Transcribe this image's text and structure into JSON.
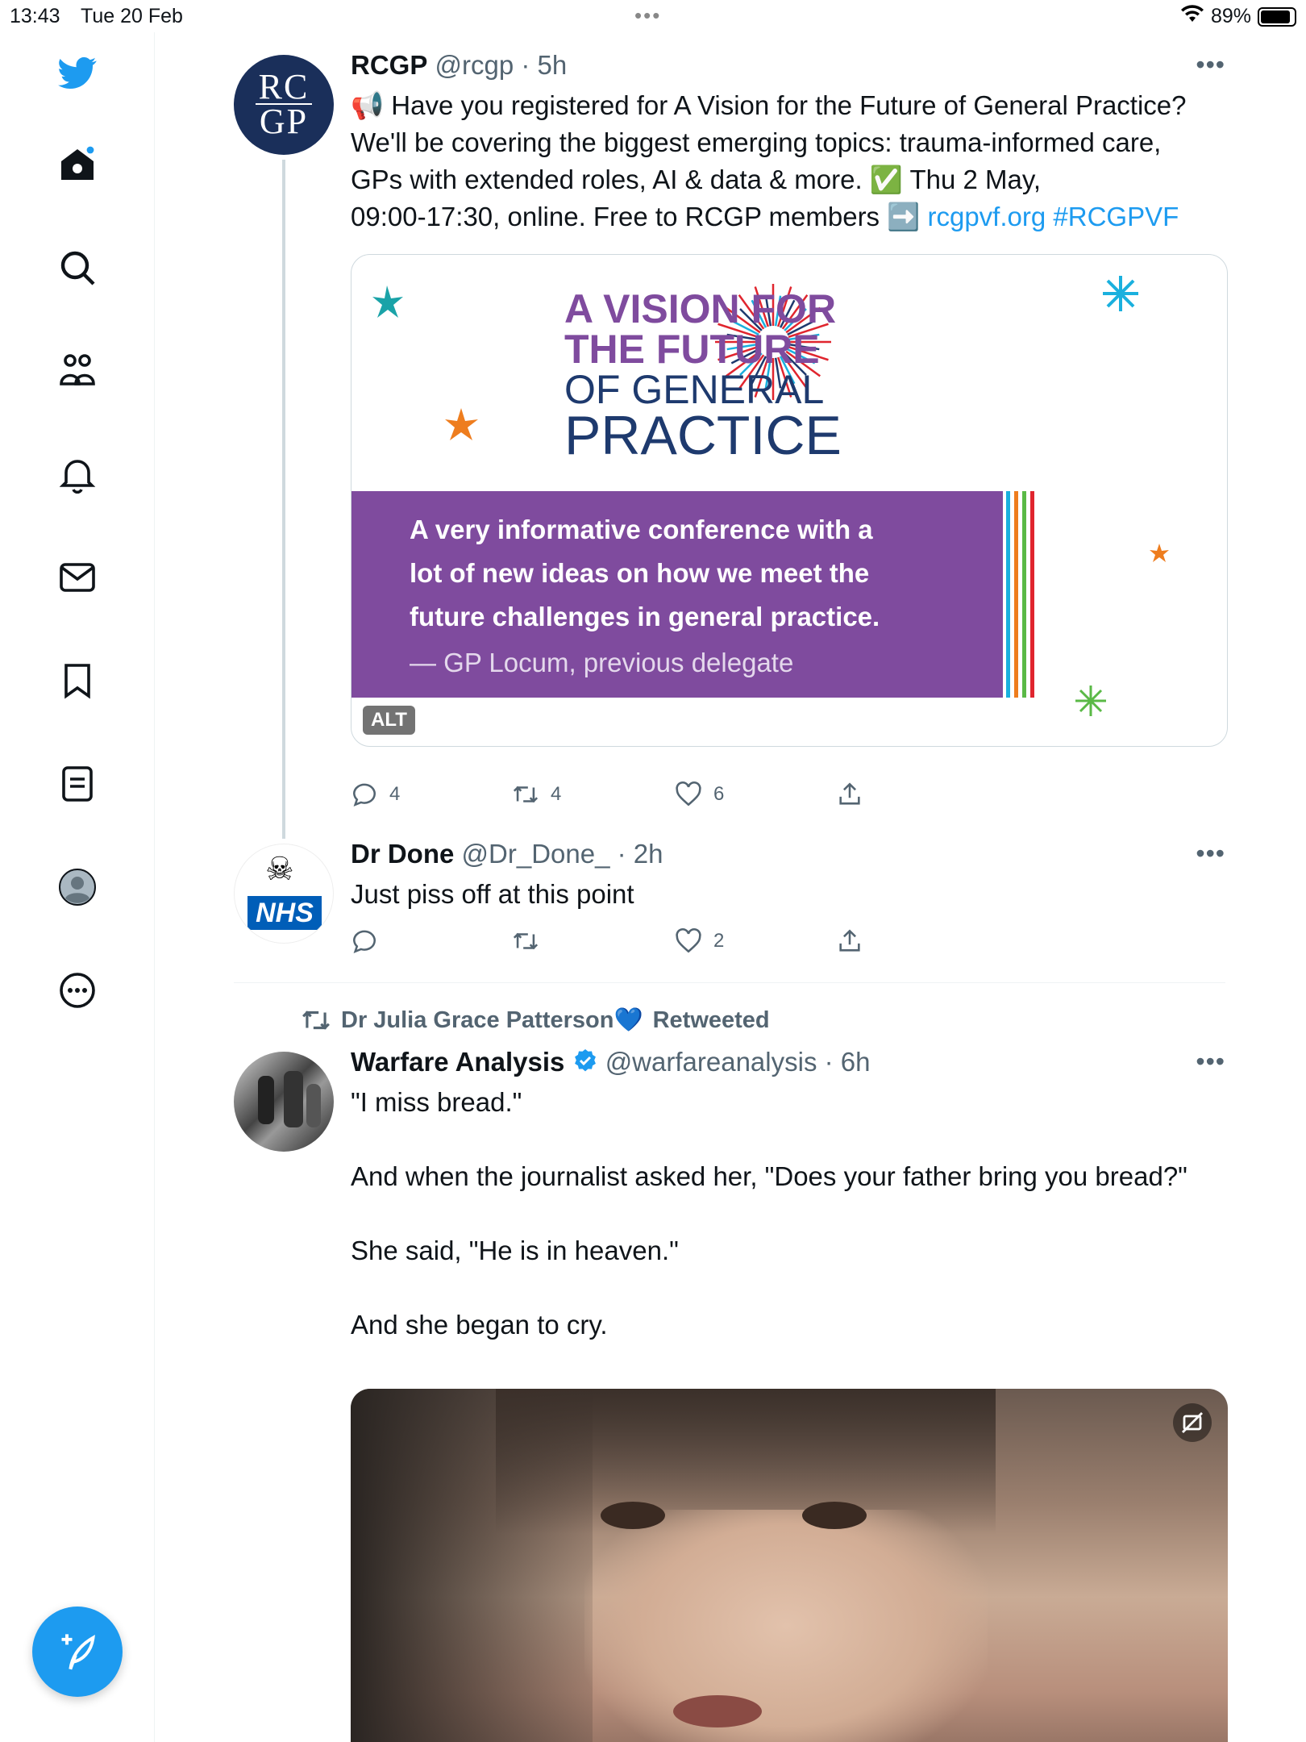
{
  "status_bar": {
    "time": "13:43",
    "date": "Tue 20 Feb",
    "battery": "89%",
    "battery_level": 0.89
  },
  "sidebar": {
    "items": [
      "twitter-logo",
      "home",
      "search",
      "communities",
      "notifications",
      "messages",
      "bookmarks",
      "lists",
      "profile",
      "more"
    ]
  },
  "tweets": [
    {
      "name": "RCGP",
      "handle": "@rcgp",
      "time": "· 5h",
      "avatar_text_top": "RC",
      "avatar_text_bottom": "GP",
      "text_line1": "📢 Have you registered for A Vision for the Future of General Practice?",
      "text_line2": "We'll be covering the biggest emerging topics: trauma-informed care,",
      "text_line3": "GPs with extended roles, AI & data & more. ✅ Thu 2 May,",
      "text_line4_plain": "09:00-17:30, online. Free to RCGP members ➡️ ",
      "text_link": "rcgpvf.org",
      "text_hashtag": "#RCGPVF",
      "card": {
        "title_line1": "A VISION FOR",
        "title_line2": "THE FUTURE",
        "title_line3": "OF GENERAL",
        "title_line4": "PRACTICE",
        "quote_line1": "A very informative conference with a",
        "quote_line2": "lot of new ideas on how we meet the",
        "quote_line3": "future challenges in general practice.",
        "attribution": "— GP Locum, previous delegate",
        "alt": "ALT"
      },
      "replies": "4",
      "retweets": "4",
      "likes": "6"
    },
    {
      "name": "Dr Done",
      "handle": "@Dr_Done_",
      "time": "· 2h",
      "avatar_text": "NHS",
      "text": "Just piss off at this point",
      "replies": "",
      "retweets": "",
      "likes": "2"
    },
    {
      "retweeted_by": "Dr Julia Grace Patterson💙",
      "retweeted_label": "Retweeted",
      "name": "Warfare Analysis",
      "handle": "@warfareanalysis",
      "time": "· 6h",
      "para1": "\"I miss bread.\"",
      "para2": "And when the journalist asked her, \"Does your father bring you bread?\"",
      "para3": "She said, \"He is in heaven.\"",
      "para4": "And she began to cry."
    }
  ],
  "colors": {
    "accent": "#1d9bf0",
    "purple": "#7f4b9e",
    "navy": "#1e3a6e",
    "text_secondary": "#536471"
  }
}
